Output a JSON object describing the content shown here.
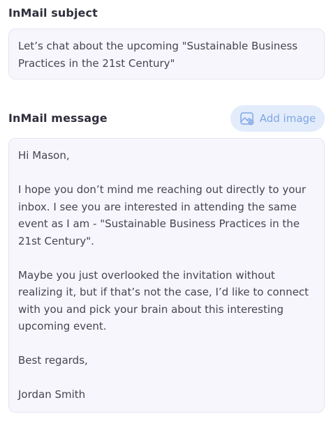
{
  "subject": {
    "label": "InMail subject",
    "value": "Let’s chat about the upcoming \"Sustainable Business Practices in the 21st Century\""
  },
  "message": {
    "label": "InMail message",
    "add_image_label": "Add image",
    "add_image_icon": "image-icon",
    "value": "Hi Mason,\n\nI hope you don’t mind me reaching out directly to your inbox. I see you are interested in attending the same event as I am - \"Sustainable Business Practices in the 21st Century\".\n\nMaybe you just overlooked the invitation without realizing it, but if that’s not the case, I’d like to connect with you and pick your brain about this interesting upcoming event.\n\nBest regards,\n\nJordan Smith"
  },
  "colors": {
    "accent": "#7fa6e3",
    "accent_bg": "#e3ecfb",
    "field_bg": "#f7f6fc"
  }
}
